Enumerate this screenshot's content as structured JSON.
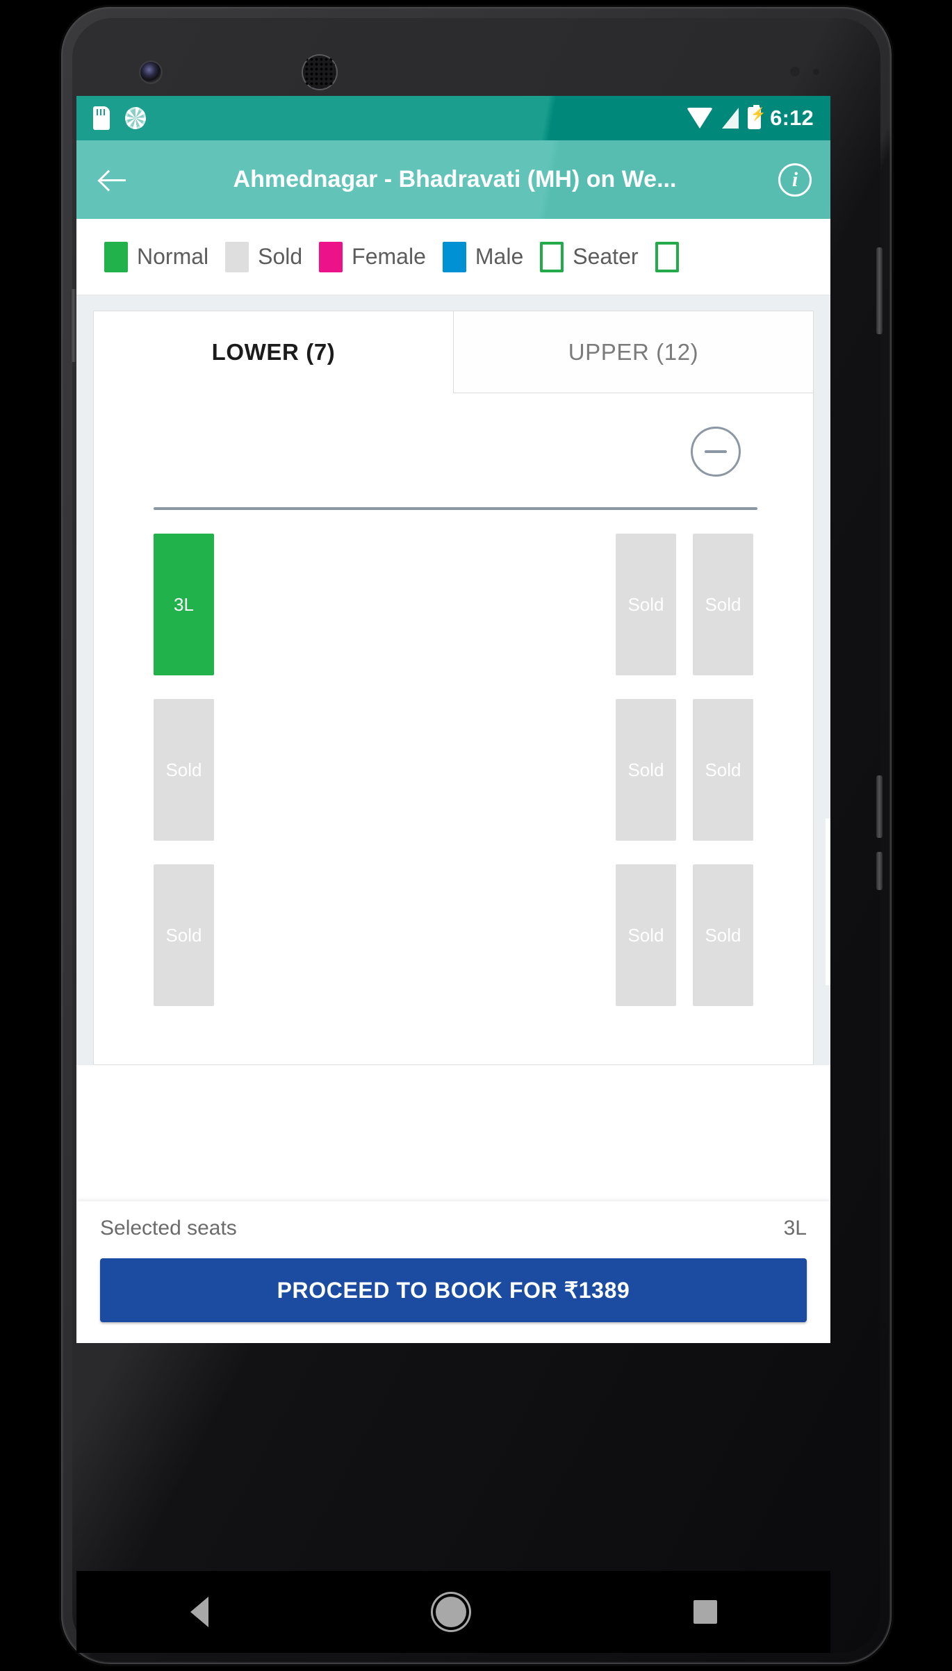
{
  "statusbar": {
    "time": "6:12",
    "icons": [
      "sdcard-icon",
      "sync-icon",
      "wifi-icon",
      "signal-icon",
      "battery-charging-icon"
    ]
  },
  "appbar": {
    "back_label": "",
    "title": "Ahmednagar - Bhadravati (MH) on We...",
    "info_label": "i"
  },
  "legend": {
    "items": [
      {
        "label": "Normal",
        "color": "#22b24c",
        "style": "filled"
      },
      {
        "label": "Sold",
        "color": "#dedede",
        "style": "filled"
      },
      {
        "label": "Female",
        "color": "#ec1388",
        "style": "filled"
      },
      {
        "label": "Male",
        "color": "#0091d5",
        "style": "filled"
      },
      {
        "label": "Seater",
        "color": "#22aa4b",
        "style": "outline"
      },
      {
        "label": "",
        "color": "#22aa4b",
        "style": "outline"
      }
    ]
  },
  "tabs": [
    {
      "label": "LOWER (7)",
      "active": true
    },
    {
      "label": "UPPER (12)",
      "active": false
    }
  ],
  "deck": {
    "steering_icon": "steering-wheel-icon",
    "rows": [
      {
        "left": [
          {
            "label": "3L",
            "state": "selected"
          }
        ],
        "right": [
          {
            "label": "Sold",
            "state": "sold"
          },
          {
            "label": "Sold",
            "state": "sold"
          }
        ]
      },
      {
        "left": [
          {
            "label": "Sold",
            "state": "sold"
          }
        ],
        "right": [
          {
            "label": "Sold",
            "state": "sold"
          },
          {
            "label": "Sold",
            "state": "sold"
          }
        ]
      },
      {
        "left": [
          {
            "label": "Sold",
            "state": "sold"
          }
        ],
        "right": [
          {
            "label": "Sold",
            "state": "sold"
          },
          {
            "label": "Sold",
            "state": "sold"
          }
        ]
      }
    ]
  },
  "bottombar": {
    "selected_label": "Selected seats",
    "selected_value": "3L",
    "proceed_label": "PROCEED TO BOOK FOR ₹1389"
  },
  "navbar": {
    "back": "nav-back-icon",
    "home": "nav-home-icon",
    "recents": "nav-recents-icon"
  },
  "colors": {
    "status_bar": "#1b9e8e",
    "app_bar": "#62c4b8",
    "seat_selected": "#22b24c",
    "seat_sold": "#dedede",
    "proceed_button": "#1b4ca1"
  }
}
